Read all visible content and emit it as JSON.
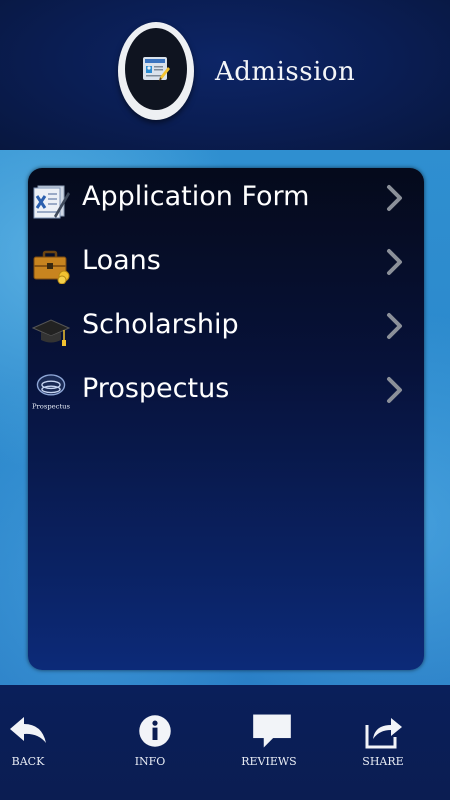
{
  "header": {
    "title": "Admission",
    "icon": "document-icon"
  },
  "menu": {
    "items": [
      {
        "label": "Application Form",
        "icon": "application-form-icon"
      },
      {
        "label": "Loans",
        "icon": "briefcase-icon"
      },
      {
        "label": "Scholarship",
        "icon": "graduation-cap-icon"
      },
      {
        "label": "Prospectus",
        "icon": "prospectus-icon",
        "icon_text": "Prospectus"
      }
    ]
  },
  "bottom_nav": {
    "tabs": [
      {
        "label": "BACK",
        "icon": "back-arrow-icon"
      },
      {
        "label": "INFO",
        "icon": "info-icon"
      },
      {
        "label": "REVIEWS",
        "icon": "speech-bubble-icon"
      },
      {
        "label": "SHARE",
        "icon": "share-icon"
      }
    ]
  },
  "colors": {
    "header_bg": "#0a1d52",
    "panel_bg_top": "#050a1b",
    "panel_bg_bottom": "#0c2a78",
    "water": "#2f8fd0",
    "text": "#ffffff"
  }
}
